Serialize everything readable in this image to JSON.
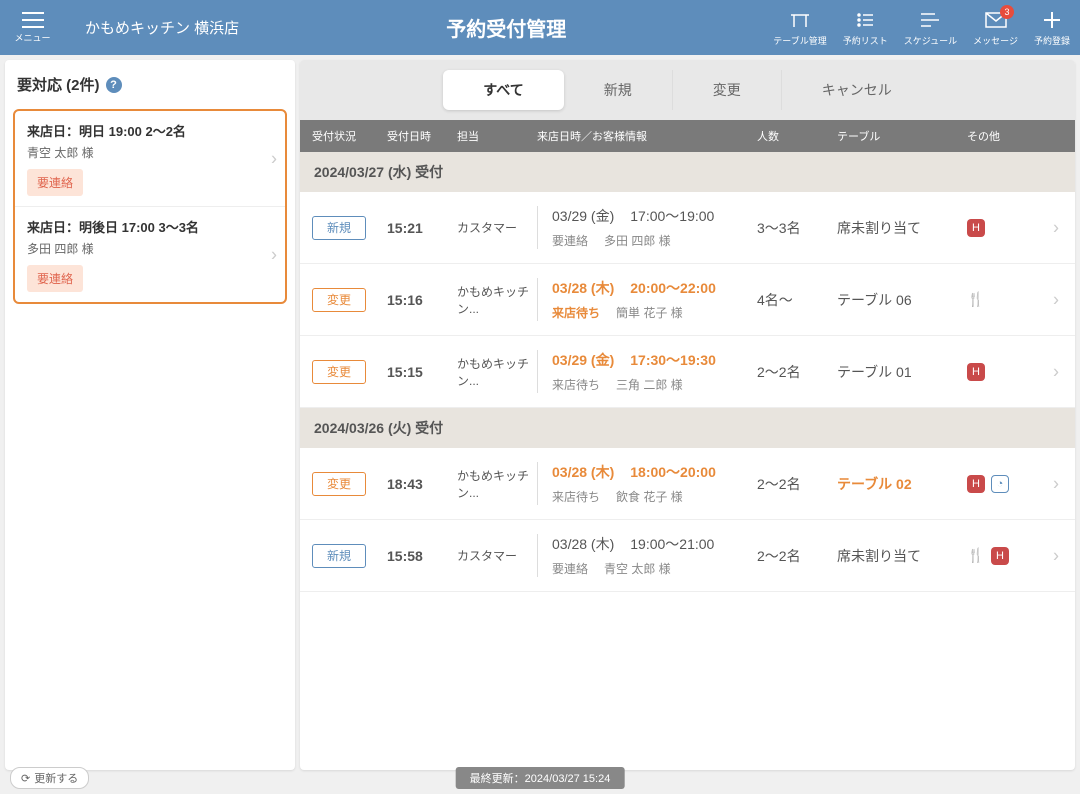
{
  "header": {
    "menu_label": "メニュー",
    "store_name": "かもめキッチン 横浜店",
    "title": "予約受付管理",
    "icons": [
      {
        "label": "テーブル管理"
      },
      {
        "label": "予約リスト"
      },
      {
        "label": "スケジュール"
      },
      {
        "label": "メッセージ",
        "badge": "3"
      },
      {
        "label": "予約登録"
      }
    ]
  },
  "sidebar": {
    "header": "要対応 (2件)",
    "items": [
      {
        "line1": "来店日：明日 19:00 2～2名",
        "line2": "青空 太郎 様",
        "badge": "要連絡"
      },
      {
        "line1": "来店日：明後日 17:00 3～3名",
        "line2": "多田 四郎 様",
        "badge": "要連絡"
      }
    ]
  },
  "tabs": [
    "すべて",
    "新規",
    "変更",
    "キャンセル"
  ],
  "columns": {
    "status": "受付状況",
    "time": "受付日時",
    "staff": "担当",
    "visit": "来店日時／お客様情報",
    "people": "人数",
    "table": "テーブル",
    "other": "その他"
  },
  "groups": [
    {
      "header": "2024/03/27 (水) 受付",
      "rows": [
        {
          "status": "新規",
          "status_class": "new",
          "time": "15:21",
          "staff": "カスタマー",
          "date": "03/29 (金)",
          "vtime": "17:00～19:00",
          "sub1": "要連絡",
          "sub2": "多田 四郎 様",
          "people": "3～3名",
          "table": "席未割り当て",
          "orange": false,
          "icons": [
            "red"
          ]
        },
        {
          "status": "変更",
          "status_class": "change",
          "time": "15:16",
          "staff": "かもめキッチン...",
          "date": "03/28 (木)",
          "vtime": "20:00～22:00",
          "sub1": "来店待ち",
          "sub1_orange": true,
          "sub2": "簡単 花子 様",
          "people": "4名～",
          "table": "テーブル 06",
          "orange": true,
          "icons": [
            "fork"
          ]
        },
        {
          "status": "変更",
          "status_class": "change",
          "time": "15:15",
          "staff": "かもめキッチン...",
          "date": "03/29 (金)",
          "vtime": "17:30～19:30",
          "sub1": "来店待ち",
          "sub2": "三角 二郎 様",
          "people": "2～2名",
          "table": "テーブル 01",
          "orange": true,
          "icons": [
            "red"
          ]
        }
      ]
    },
    {
      "header": "2024/03/26 (火) 受付",
      "rows": [
        {
          "status": "変更",
          "status_class": "change",
          "time": "18:43",
          "staff": "かもめキッチン...",
          "date": "03/28 (木)",
          "vtime": "18:00～20:00",
          "sub1": "来店待ち",
          "sub2": "飲食 花子 様",
          "people": "2～2名",
          "table": "テーブル 02",
          "table_orange": true,
          "orange": true,
          "icons": [
            "red",
            "blue"
          ]
        },
        {
          "status": "新規",
          "status_class": "new",
          "time": "15:58",
          "staff": "カスタマー",
          "date": "03/28 (木)",
          "vtime": "19:00～21:00",
          "sub1": "要連絡",
          "sub2": "青空 太郎 様",
          "people": "2～2名",
          "table": "席未割り当て",
          "orange": false,
          "icons": [
            "fork",
            "red"
          ]
        }
      ]
    }
  ],
  "footer": {
    "refresh": "更新する",
    "updated": "最終更新：2024/03/27 15:24"
  }
}
